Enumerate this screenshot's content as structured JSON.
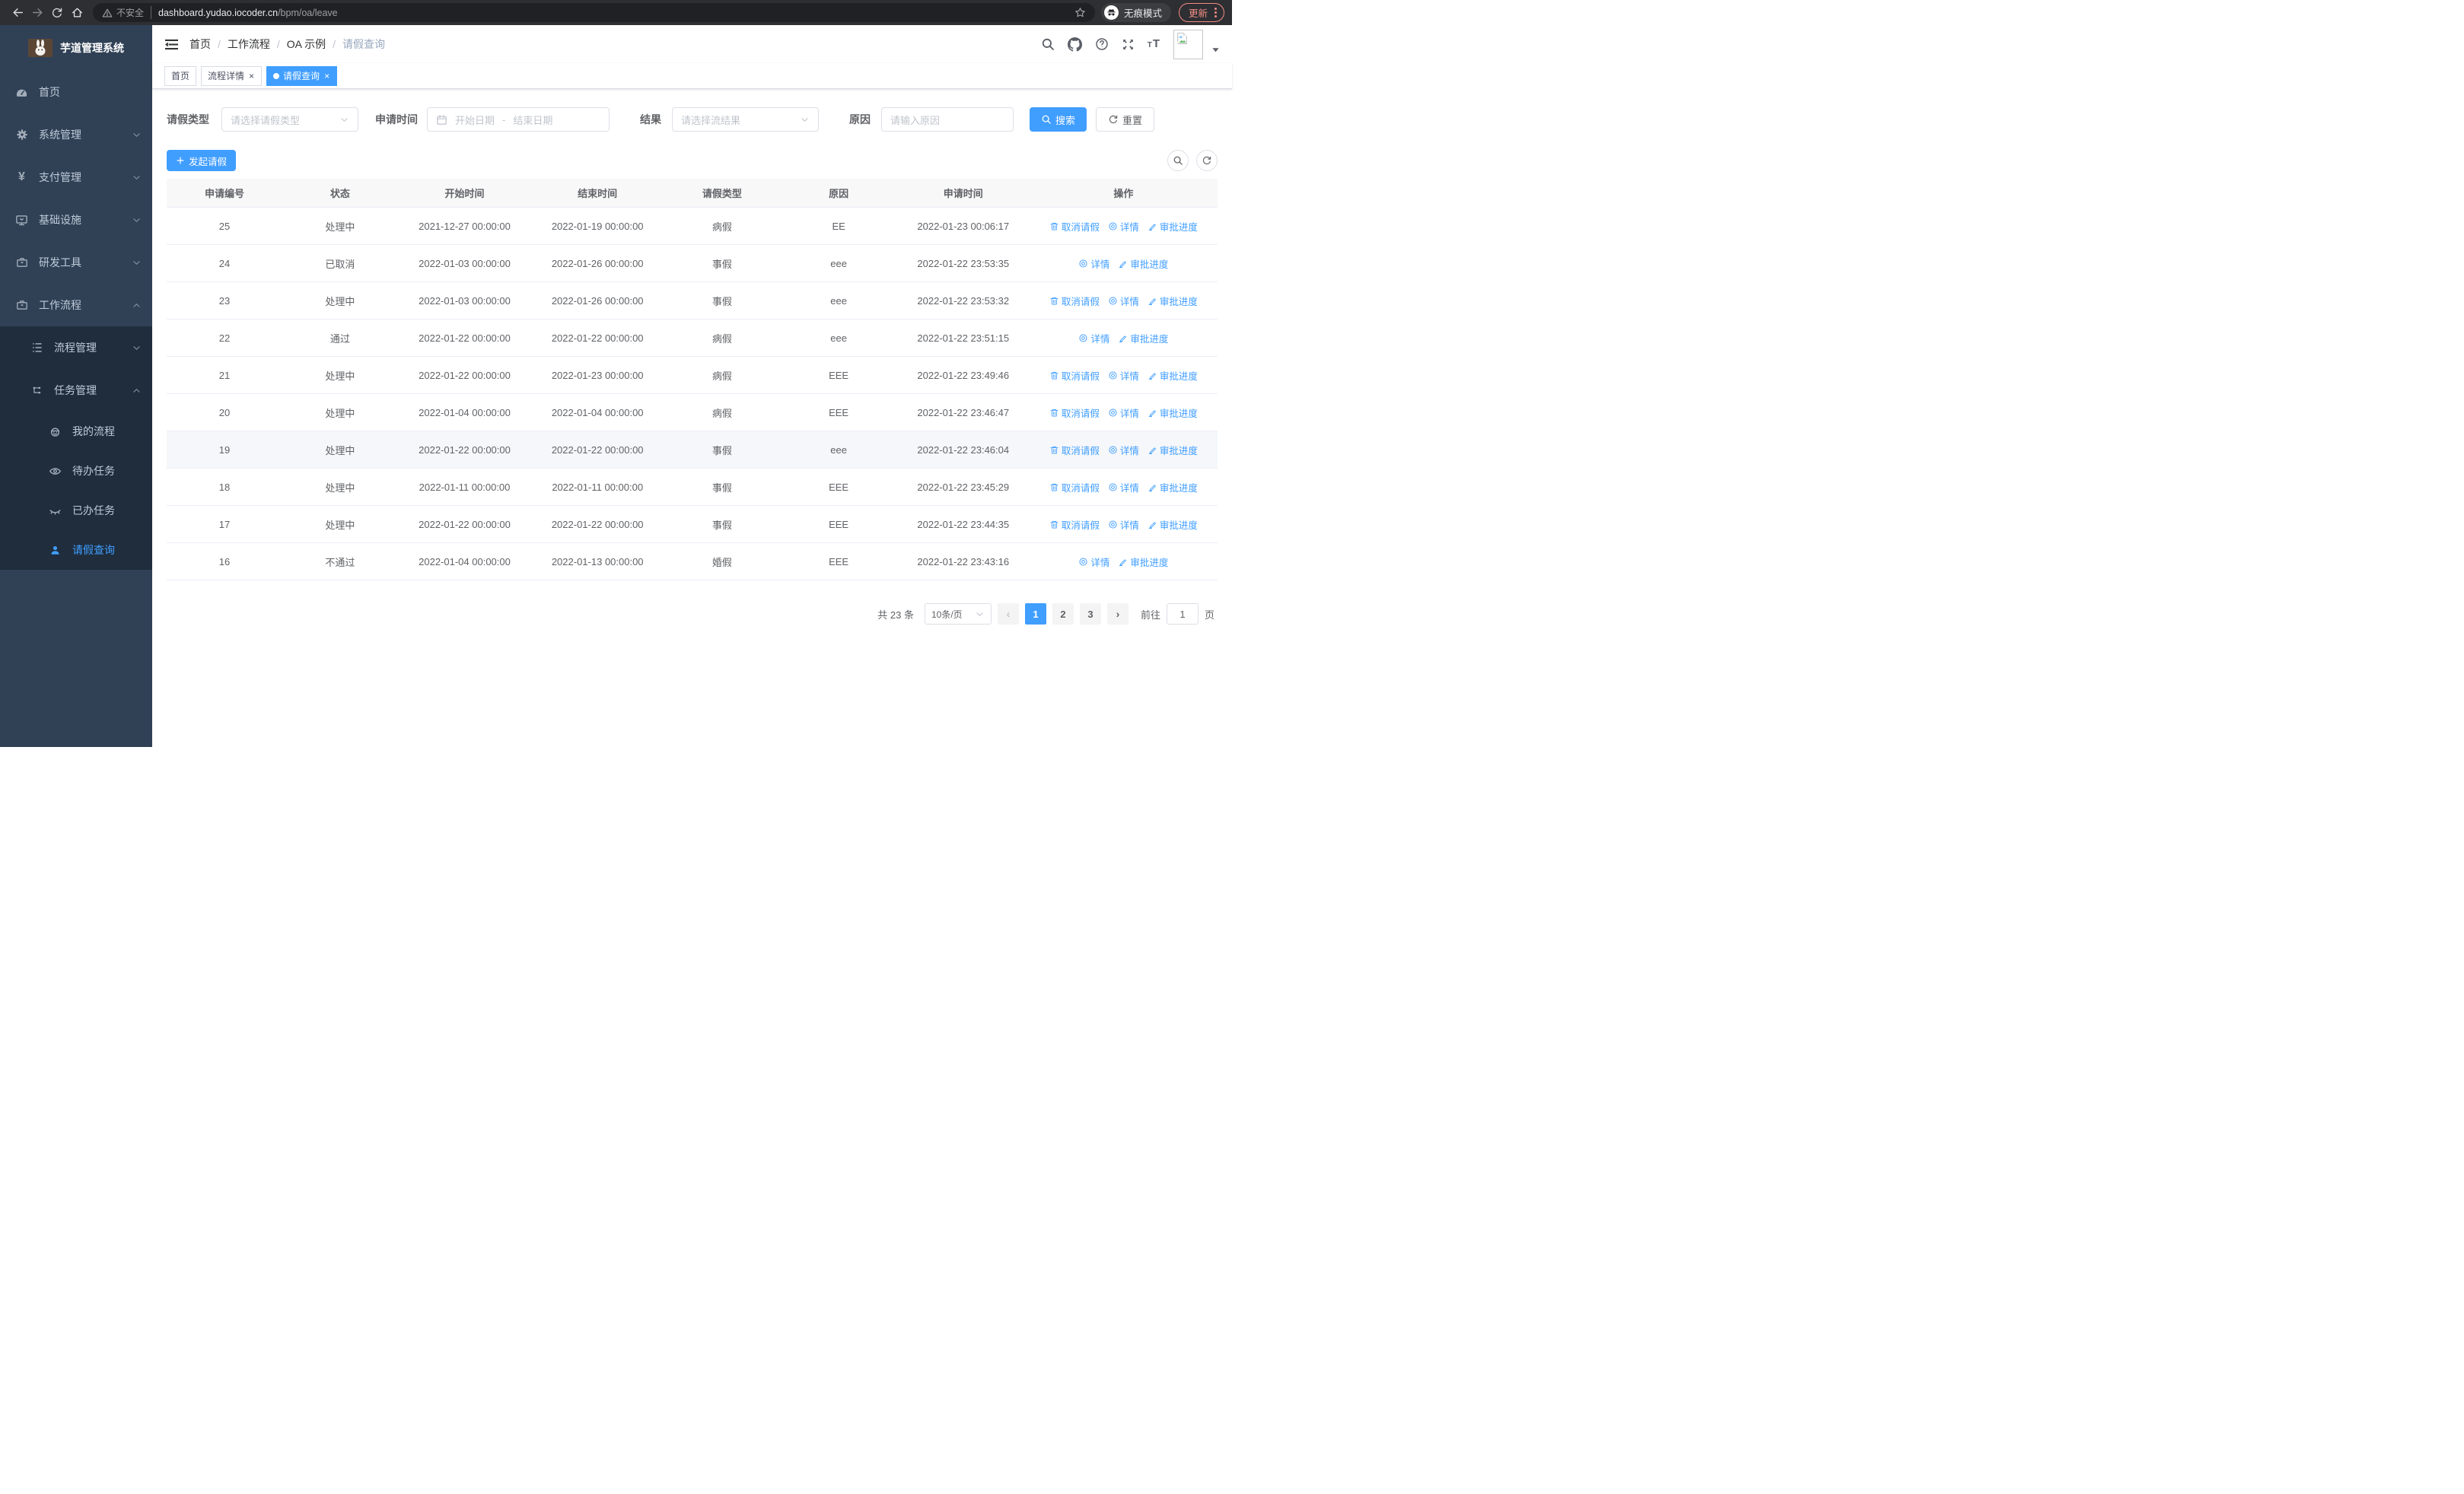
{
  "browser": {
    "security_label": "不安全",
    "url_host": "dashboard.yudao.iocoder.cn",
    "url_path": "/bpm/oa/leave",
    "incognito_label": "无痕模式",
    "update_label": "更新"
  },
  "sidebar": {
    "logo_title": "芋道管理系统",
    "items": [
      {
        "label": "首页",
        "icon": "dashboard-icon"
      },
      {
        "label": "系统管理",
        "icon": "gear-icon"
      },
      {
        "label": "支付管理",
        "icon": "yen-icon"
      },
      {
        "label": "基础设施",
        "icon": "monitor-icon"
      },
      {
        "label": "研发工具",
        "icon": "toolbox-icon"
      },
      {
        "label": "工作流程",
        "icon": "briefcase-icon"
      }
    ],
    "submenu": [
      {
        "label": "流程管理",
        "icon": "list-tree-icon"
      },
      {
        "label": "任务管理",
        "icon": "flow-icon"
      }
    ],
    "task_items": [
      {
        "label": "我的流程",
        "icon": "face-icon"
      },
      {
        "label": "待办任务",
        "icon": "eye-icon"
      },
      {
        "label": "已办任务",
        "icon": "eye-closed-icon"
      },
      {
        "label": "请假查询",
        "icon": "person-icon",
        "active": true
      }
    ]
  },
  "header": {
    "breadcrumb": [
      "首页",
      "工作流程",
      "OA 示例",
      "请假查询"
    ]
  },
  "tabs": [
    {
      "label": "首页",
      "closable": false,
      "active": false
    },
    {
      "label": "流程详情",
      "closable": true,
      "active": false
    },
    {
      "label": "请假查询",
      "closable": true,
      "active": true
    }
  ],
  "filters": {
    "leave_type_label": "请假类型",
    "leave_type_placeholder": "请选择请假类型",
    "apply_time_label": "申请时间",
    "start_date_placeholder": "开始日期",
    "range_separator": "-",
    "end_date_placeholder": "结束日期",
    "result_label": "结果",
    "result_placeholder": "请选择流结果",
    "reason_label": "原因",
    "reason_placeholder": "请输入原因",
    "search_label": "搜索",
    "reset_label": "重置"
  },
  "toolbar": {
    "create_label": "发起请假"
  },
  "table": {
    "columns": [
      "申请编号",
      "状态",
      "开始时间",
      "结束时间",
      "请假类型",
      "原因",
      "申请时间",
      "操作"
    ],
    "actions": {
      "cancel": "取消请假",
      "detail": "详情",
      "progress": "审批进度"
    },
    "rows": [
      {
        "id": "25",
        "status": "处理中",
        "start": "2021-12-27 00:00:00",
        "end": "2022-01-19 00:00:00",
        "type": "病假",
        "reason": "EE",
        "apply_time": "2022-01-23 00:06:17",
        "cancellable": true,
        "hovered": false
      },
      {
        "id": "24",
        "status": "已取消",
        "start": "2022-01-03 00:00:00",
        "end": "2022-01-26 00:00:00",
        "type": "事假",
        "reason": "eee",
        "apply_time": "2022-01-22 23:53:35",
        "cancellable": false,
        "hovered": false
      },
      {
        "id": "23",
        "status": "处理中",
        "start": "2022-01-03 00:00:00",
        "end": "2022-01-26 00:00:00",
        "type": "事假",
        "reason": "eee",
        "apply_time": "2022-01-22 23:53:32",
        "cancellable": true,
        "hovered": false
      },
      {
        "id": "22",
        "status": "通过",
        "start": "2022-01-22 00:00:00",
        "end": "2022-01-22 00:00:00",
        "type": "病假",
        "reason": "eee",
        "apply_time": "2022-01-22 23:51:15",
        "cancellable": false,
        "hovered": false
      },
      {
        "id": "21",
        "status": "处理中",
        "start": "2022-01-22 00:00:00",
        "end": "2022-01-23 00:00:00",
        "type": "病假",
        "reason": "EEE",
        "apply_time": "2022-01-22 23:49:46",
        "cancellable": true,
        "hovered": false
      },
      {
        "id": "20",
        "status": "处理中",
        "start": "2022-01-04 00:00:00",
        "end": "2022-01-04 00:00:00",
        "type": "病假",
        "reason": "EEE",
        "apply_time": "2022-01-22 23:46:47",
        "cancellable": true,
        "hovered": false
      },
      {
        "id": "19",
        "status": "处理中",
        "start": "2022-01-22 00:00:00",
        "end": "2022-01-22 00:00:00",
        "type": "事假",
        "reason": "eee",
        "apply_time": "2022-01-22 23:46:04",
        "cancellable": true,
        "hovered": true
      },
      {
        "id": "18",
        "status": "处理中",
        "start": "2022-01-11 00:00:00",
        "end": "2022-01-11 00:00:00",
        "type": "事假",
        "reason": "EEE",
        "apply_time": "2022-01-22 23:45:29",
        "cancellable": true,
        "hovered": false
      },
      {
        "id": "17",
        "status": "处理中",
        "start": "2022-01-22 00:00:00",
        "end": "2022-01-22 00:00:00",
        "type": "事假",
        "reason": "EEE",
        "apply_time": "2022-01-22 23:44:35",
        "cancellable": true,
        "hovered": false
      },
      {
        "id": "16",
        "status": "不通过",
        "start": "2022-01-04 00:00:00",
        "end": "2022-01-13 00:00:00",
        "type": "婚假",
        "reason": "EEE",
        "apply_time": "2022-01-22 23:43:16",
        "cancellable": false,
        "hovered": false
      }
    ]
  },
  "pagination": {
    "total_text": "共 23 条",
    "page_size": "10条/页",
    "pages": [
      "1",
      "2",
      "3"
    ],
    "active_page": "1",
    "goto_label": "前往",
    "goto_value": "1",
    "unit_label": "页"
  },
  "colors": {
    "primary": "#409eff",
    "sidebar_bg": "#304156",
    "submenu_bg": "#1f2d3d",
    "active_tab_bg": "#409eff",
    "link": "#409eff",
    "update_chip": "#f28b82",
    "table_header_bg": "#f8f8f9",
    "hover_row_bg": "#f5f7fa"
  }
}
